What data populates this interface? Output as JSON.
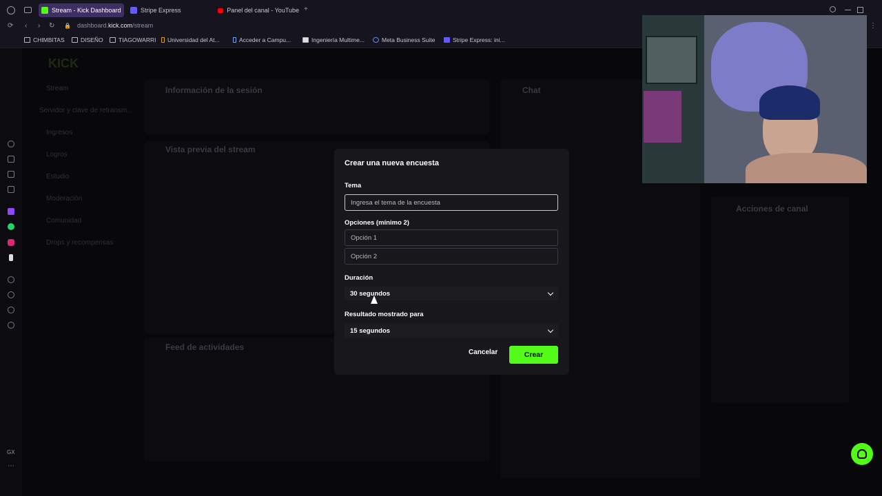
{
  "browser": {
    "tabs": [
      {
        "label": "Stream - Kick Dashboard",
        "active": true,
        "favicon": "kick-icon"
      },
      {
        "label": "Stripe Express",
        "active": false,
        "favicon": "stripe-icon"
      },
      {
        "label": "Panel del canal - YouTube",
        "active": false,
        "favicon": "youtube-icon"
      }
    ],
    "url_host": "dashboard.",
    "url_domain": "kick.com",
    "url_path": "/stream",
    "bookmarks": [
      {
        "label": "CHIMBITAS",
        "icon": "folder-icon"
      },
      {
        "label": "DISEÑO",
        "icon": "folder-icon"
      },
      {
        "label": "TIAGOWARRI",
        "icon": "folder-icon"
      },
      {
        "label": "Universidad del At...",
        "icon": "university-icon"
      },
      {
        "label": "Acceder a Campu...",
        "icon": "campus-icon"
      },
      {
        "label": "Ingeniería Multime...",
        "icon": "page-icon"
      },
      {
        "label": "Meta Business Suite",
        "icon": "meta-icon"
      },
      {
        "label": "Stripe Express: ini...",
        "icon": "stripe-icon"
      }
    ]
  },
  "background": {
    "logo": "KICK",
    "nav": [
      "Stream",
      "Servidor y clave de retransm...",
      "Ingresos",
      "Logros",
      "Estudio",
      "Moderación",
      "Comunidad",
      "Drops y recompensas"
    ],
    "session_title": "Información de la sesión",
    "preview_title": "Vista previa del stream",
    "activity_title": "Feed de actividades",
    "chat_title": "Chat",
    "actions_title": "Acciones de canal"
  },
  "modal": {
    "title": "Crear una nueva encuesta",
    "topic_label": "Tema",
    "topic_placeholder": "Ingresa el tema de la encuesta",
    "options_label": "Opciones (mínimo 2)",
    "option1_placeholder": "Opción 1",
    "option2_placeholder": "Opción 2",
    "duration_label": "Duración",
    "duration_value": "30 segundos",
    "result_label": "Resultado mostrado para",
    "result_value": "15 segundos",
    "cancel": "Cancelar",
    "create": "Crear"
  },
  "colors": {
    "accent": "#53fc18",
    "tab_active": "#3d2f63",
    "modal_bg": "#18181c"
  }
}
